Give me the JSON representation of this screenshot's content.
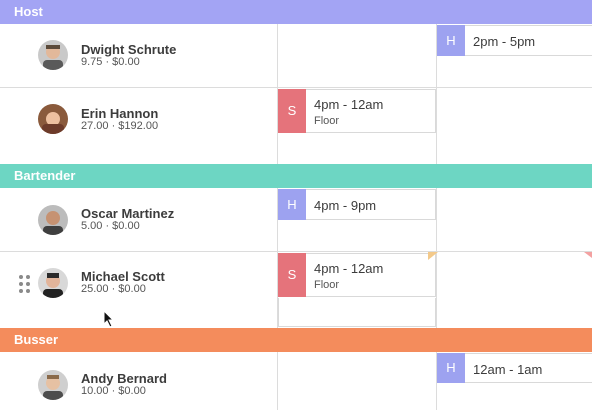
{
  "groups": {
    "host": "Host",
    "bartender": "Bartender",
    "busser": "Busser"
  },
  "employees": {
    "dwight": {
      "name": "Dwight Schrute",
      "stats": "9.75 · $0.00"
    },
    "erin": {
      "name": "Erin Hannon",
      "stats": "27.00 · $192.00"
    },
    "oscar": {
      "name": "Oscar Martinez",
      "stats": "5.00 · $0.00"
    },
    "michael": {
      "name": "Michael Scott",
      "stats": "25.00 · $0.00"
    },
    "andy": {
      "name": "Andy Bernard",
      "stats": "10.00 · $0.00"
    }
  },
  "shifts": {
    "dwight_1": {
      "badge": "H",
      "time": "2pm - 5pm"
    },
    "erin_1": {
      "badge": "S",
      "time": "4pm - 12am",
      "role": "Floor"
    },
    "oscar_1": {
      "badge": "H",
      "time": "4pm - 9pm"
    },
    "michael_1": {
      "badge": "S",
      "time": "4pm - 12am",
      "role": "Floor"
    },
    "andy_1": {
      "badge": "H",
      "time": "12am - 1am"
    }
  },
  "colors": {
    "host": "#a3a4f4",
    "bartender": "#6dd6c3",
    "busser": "#f48c5c",
    "badge_S": "#e5737b",
    "badge_H": "#9da2f0"
  },
  "icons": {
    "drag_handle": "drag-handle-icon",
    "cursor": "mouse-cursor-icon"
  }
}
